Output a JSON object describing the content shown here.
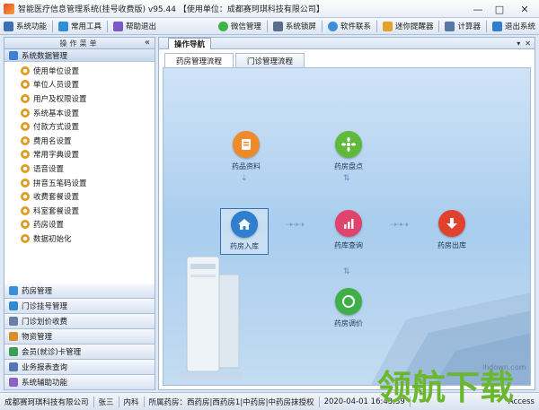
{
  "window": {
    "title": "智能医疗信息管理系统(挂号收费版) v95.44 【使用单位：成都赛珂琪科技有限公司】",
    "controls": [
      "—",
      "□",
      "✕"
    ]
  },
  "toolbar": {
    "left": [
      {
        "label": "系统功能",
        "icon": "system-icon",
        "color": "#3c6fb8"
      },
      {
        "label": "常用工具",
        "icon": "tools-icon",
        "color": "#2f8fd6"
      },
      {
        "label": "帮助退出",
        "icon": "help-exit-icon",
        "color": "#7b56c7"
      }
    ],
    "right": [
      {
        "label": "微信管理",
        "icon": "wechat-icon",
        "color": "#3bb54a"
      },
      {
        "label": "系统锁屏",
        "icon": "lock-icon",
        "color": "#5a6e8c"
      },
      {
        "label": "软件联系",
        "icon": "contact-icon",
        "color": "#3f8ed8"
      },
      {
        "label": "迷你提醒器",
        "icon": "reminder-icon",
        "color": "#e3a12e"
      },
      {
        "label": "计算器",
        "icon": "calculator-icon",
        "color": "#5577a8"
      },
      {
        "label": "退出系统",
        "icon": "exit-icon",
        "color": "#2f7fcf"
      }
    ]
  },
  "sidebar": {
    "header": "操作菜单",
    "collapse": "«",
    "active_group": {
      "label": "系统数据管理",
      "icon": "database-icon",
      "color": "#3d7fd0"
    },
    "items": [
      "使用单位设置",
      "单位人员设置",
      "用户及权限设置",
      "系统基本设置",
      "付款方式设置",
      "费用名设置",
      "常用字典设置",
      "语音设置",
      "拼音五笔码设置",
      "收费套餐设置",
      "科室套餐设置",
      "药房设置",
      "数据初始化"
    ],
    "groups": [
      {
        "label": "药房管理",
        "icon": "pharmacy-icon",
        "color": "#3a8fd8"
      },
      {
        "label": "门诊挂号管理",
        "icon": "registration-icon",
        "color": "#2f8bd0"
      },
      {
        "label": "门诊划价收费",
        "icon": "billing-icon",
        "color": "#6a7fa3"
      },
      {
        "label": "物资管理",
        "icon": "supplies-icon",
        "color": "#d98d2b"
      },
      {
        "label": "会员(就诊)卡管理",
        "icon": "card-icon",
        "color": "#3b9e53"
      },
      {
        "label": "业务报表查询",
        "icon": "report-icon",
        "color": "#5675b5"
      },
      {
        "label": "系统辅助功能",
        "icon": "assist-icon",
        "color": "#8b63c4"
      }
    ]
  },
  "main": {
    "nav_tab": "操作导航",
    "ctrls": [
      "▾",
      "✕"
    ],
    "sub_tabs": [
      "药房管理流程",
      "门诊管理流程"
    ],
    "flow": {
      "nodes": [
        {
          "key": "resource",
          "label": "药品资料",
          "icon": "drug-info-icon",
          "color": "#ee8a2a"
        },
        {
          "key": "inventory",
          "label": "药房盘点",
          "icon": "inventory-icon",
          "color": "#5fba3c"
        },
        {
          "key": "inbound",
          "label": "药房入库",
          "icon": "home-inbound-icon",
          "color": "#2f7fcf"
        },
        {
          "key": "query",
          "label": "药库查询",
          "icon": "stock-query-icon",
          "color": "#e0446d"
        },
        {
          "key": "outbound",
          "label": "药房出库",
          "icon": "outbound-icon",
          "color": "#e0422e"
        },
        {
          "key": "transfer",
          "label": "药房调价",
          "icon": "price-adjust-icon",
          "color": "#3fb049"
        }
      ]
    }
  },
  "status": {
    "company": "成都赛珂琪科技有限公司",
    "user": "张三",
    "dept": "内科",
    "pharmacy": "所属药房：西药房|西药房1|中药房|中药房抹授权",
    "datetime": "2020-04-01 16:43:39",
    "db": "Access"
  },
  "watermark": {
    "text": "领航下载",
    "url": "lhdown.com"
  }
}
